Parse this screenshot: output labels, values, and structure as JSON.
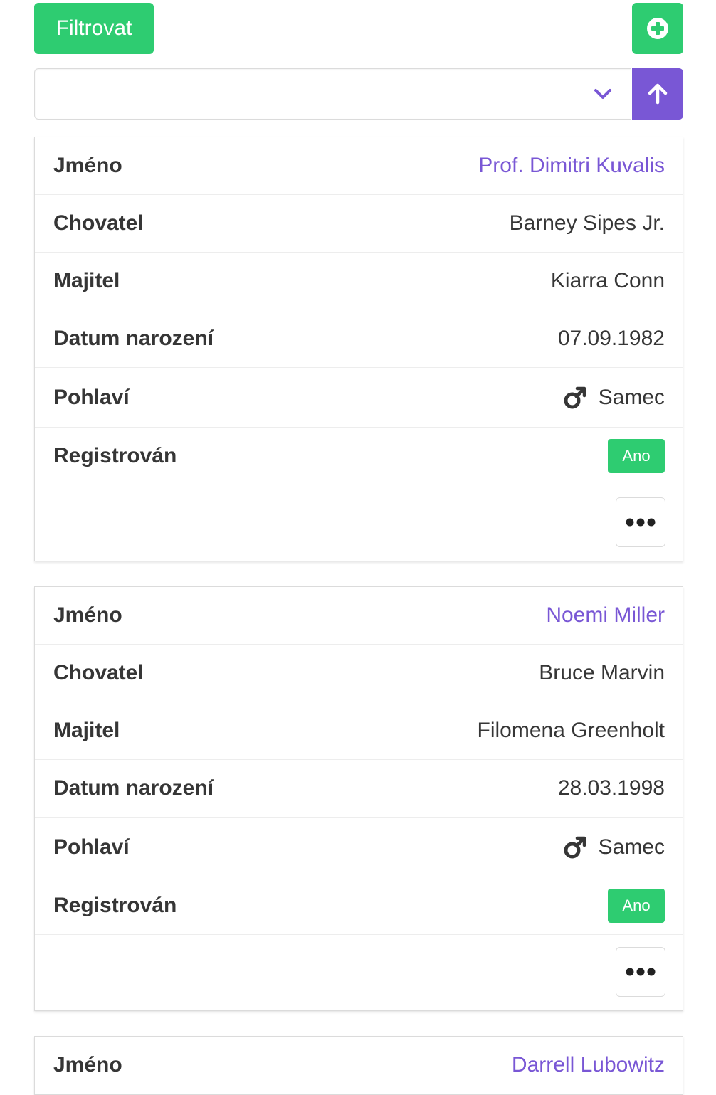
{
  "toolbar": {
    "filter_label": "Filtrovat",
    "add_icon": "plus-circle-icon"
  },
  "sort": {
    "selected_value": "",
    "direction_icon": "arrow-up-icon"
  },
  "labels": {
    "name": "Jméno",
    "breeder": "Chovatel",
    "owner": "Majitel",
    "birth_date": "Datum narození",
    "sex": "Pohlaví",
    "registered": "Registrován"
  },
  "colors": {
    "success": "#2ecc71",
    "primary": "#7957d5",
    "text": "#363636",
    "border": "#dbdbdb"
  },
  "cards": [
    {
      "name": "Prof. Dimitri Kuvalis",
      "breeder": "Barney Sipes Jr.",
      "owner": "Kiarra Conn",
      "birth_date": "07.09.1982",
      "sex": "Samec",
      "registered": "Ano"
    },
    {
      "name": "Noemi Miller",
      "breeder": "Bruce Marvin",
      "owner": "Filomena Greenholt",
      "birth_date": "28.03.1998",
      "sex": "Samec",
      "registered": "Ano"
    },
    {
      "name": "Darrell Lubowitz"
    }
  ]
}
